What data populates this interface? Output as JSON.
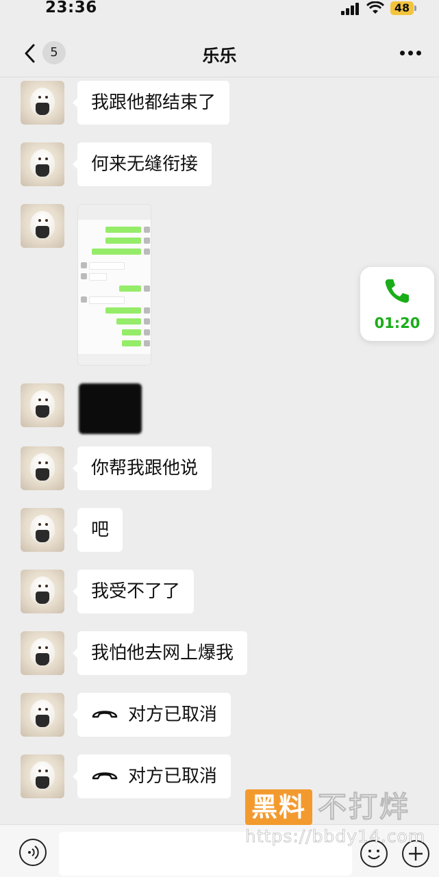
{
  "status_bar": {
    "time": "23:36",
    "battery": "48"
  },
  "header": {
    "back_count": "5",
    "title": "乐乐"
  },
  "messages": [
    {
      "type": "text",
      "text": "我跟他都结束了"
    },
    {
      "type": "text",
      "text": "何来无缝衔接"
    },
    {
      "type": "image",
      "icon": "chat-screenshot"
    },
    {
      "type": "image",
      "icon": "censored-image"
    },
    {
      "type": "text",
      "text": "你帮我跟他说"
    },
    {
      "type": "text",
      "text": "吧"
    },
    {
      "type": "text",
      "text": "我受不了了"
    },
    {
      "type": "text",
      "text": "我怕他去网上爆我"
    },
    {
      "type": "call",
      "text": "对方已取消",
      "icon": "hangup-icon"
    },
    {
      "type": "call",
      "text": "对方已取消",
      "icon": "hangup-icon"
    }
  ],
  "call_card": {
    "duration": "01:20",
    "icon": "phone-icon",
    "color": "#1aad19"
  },
  "watermark": {
    "brand": "黑料",
    "slogan": "不打烊",
    "url": "https://bbdy14.com",
    "color": "#f39a2e"
  },
  "input_bar": {
    "placeholder": ""
  }
}
